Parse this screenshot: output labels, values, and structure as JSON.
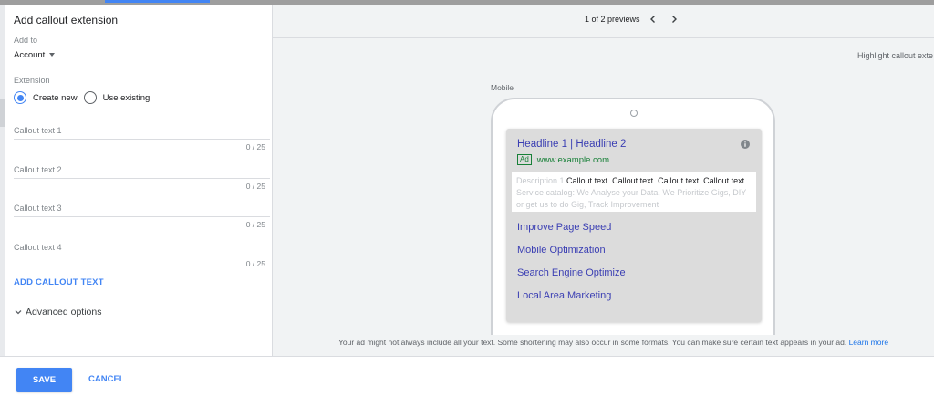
{
  "panel": {
    "title": "Add callout extension",
    "add_to_label": "Add to",
    "add_to_value": "Account",
    "extension_label": "Extension",
    "radio_create_new": "Create new",
    "radio_use_existing": "Use existing",
    "radio_selected": "Create new",
    "fields": [
      {
        "label": "Callout text 1",
        "counter": "0 / 25"
      },
      {
        "label": "Callout text 2",
        "counter": "0 / 25"
      },
      {
        "label": "Callout text 3",
        "counter": "0 / 25"
      },
      {
        "label": "Callout text 4",
        "counter": "0 / 25"
      }
    ],
    "add_callout_text": "ADD CALLOUT TEXT",
    "advanced_options": "Advanced options"
  },
  "preview": {
    "pager_text": "1 of 2 previews",
    "highlight_label": "Highlight callout exte",
    "device_label": "Mobile",
    "ad": {
      "headline": "Headline 1 | Headline 2",
      "badge": "Ad",
      "url": "www.example.com",
      "description_prefix": "Description 1",
      "callout_text": "Callout text. Callout text. Callout text. Callout text.",
      "description_rest": "Service catalog: We Analyse your Data, We Prioritize Gigs, DIY or get us to do Gig, Track Improvement",
      "sitelinks": [
        "Improve Page Speed",
        "Mobile Optimization",
        "Search Engine Optimize",
        "Local Area Marketing"
      ]
    },
    "disclaimer": "Your ad might not always include all your text. Some shortening may also occur in some formats. You can make sure certain text appears in your ad.",
    "learn_more": "Learn more"
  },
  "footer": {
    "save_label": "SAVE",
    "cancel_label": "CANCEL"
  },
  "colors": {
    "accent": "#4285f4",
    "link": "#3b3fb3",
    "url_green": "#188038",
    "preview_bg": "#f1f3f4"
  },
  "icons": [
    "dropdown-caret-icon",
    "radio-checked-icon",
    "radio-unchecked-icon",
    "chevron-down-icon",
    "chevron-left-icon",
    "chevron-right-icon",
    "info-icon"
  ]
}
